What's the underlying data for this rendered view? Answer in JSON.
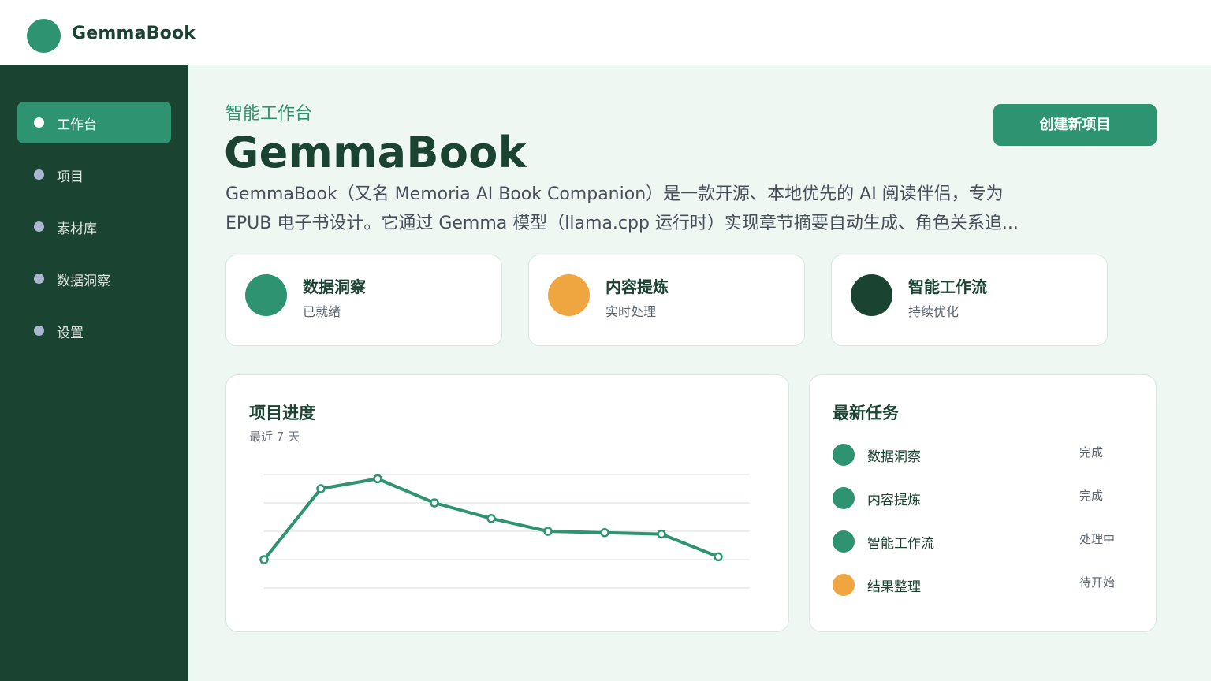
{
  "app": {
    "name": "GemmaBook"
  },
  "sidebar": {
    "items": [
      {
        "label": "工作台",
        "active": true
      },
      {
        "label": "项目",
        "active": false
      },
      {
        "label": "素材库",
        "active": false
      },
      {
        "label": "数据洞察",
        "active": false
      },
      {
        "label": "设置",
        "active": false
      }
    ]
  },
  "header": {
    "eyebrow": "智能工作台",
    "title": "GemmaBook",
    "description_line1": "GemmaBook（又名 Memoria AI Book Companion）是一款开源、本地优先的 AI 阅读伴侣，专为",
    "description_line2": "EPUB 电子书设计。它通过 Gemma 模型（llama.cpp 运行时）实现章节摘要自动生成、角色关系追...",
    "create_button": "创建新项目"
  },
  "stats": [
    {
      "title": "数据洞察",
      "subtitle": "已就绪",
      "color": "#2d9370"
    },
    {
      "title": "内容提炼",
      "subtitle": "实时处理",
      "color": "#f0a640"
    },
    {
      "title": "智能工作流",
      "subtitle": "持续优化",
      "color": "#1b4332"
    }
  ],
  "progress_panel": {
    "title": "项目进度",
    "subtitle": "最近 7 天"
  },
  "chart_data": {
    "type": "line",
    "title": "项目进度",
    "subtitle": "最近 7 天",
    "xlabel": "",
    "ylabel": "",
    "grid": true,
    "ylim": [
      0,
      40
    ],
    "series": [
      {
        "values": [
          10,
          35,
          38.5,
          30,
          24.5,
          20,
          19.5,
          19,
          11
        ],
        "color": "#2d9370"
      }
    ]
  },
  "tasks_panel": {
    "title": "最新任务",
    "items": [
      {
        "label": "数据洞察",
        "status": "完成",
        "color": "#2d9370"
      },
      {
        "label": "内容提炼",
        "status": "完成",
        "color": "#2d9370"
      },
      {
        "label": "智能工作流",
        "status": "处理中",
        "color": "#2d9370"
      },
      {
        "label": "结果整理",
        "status": "待开始",
        "color": "#f0a640"
      }
    ]
  }
}
